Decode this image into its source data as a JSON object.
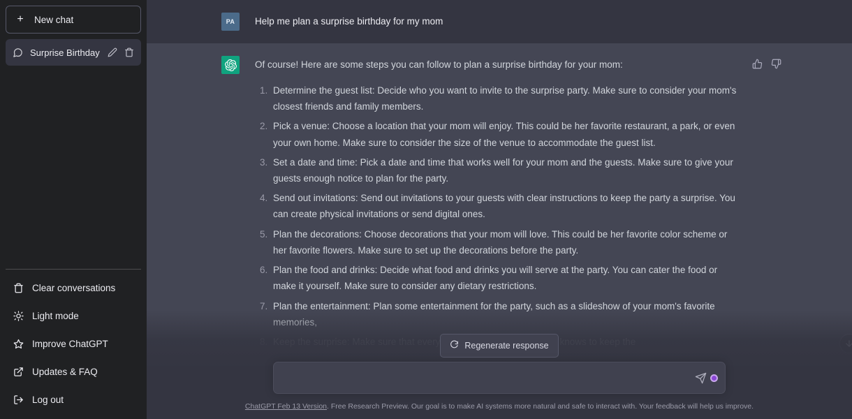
{
  "sidebar": {
    "new_chat_label": "New chat",
    "new_chat_icon": "plus-icon",
    "conversations": [
      {
        "title": "Surprise Birthday Planni",
        "chat_icon": "message-square-icon",
        "edit_icon": "pencil-icon",
        "delete_icon": "trash-icon",
        "active": true
      }
    ],
    "menu": [
      {
        "label": "Clear conversations",
        "icon": "trash-icon"
      },
      {
        "label": "Light mode",
        "icon": "sun-icon"
      },
      {
        "label": "Improve ChatGPT",
        "icon": "star-icon"
      },
      {
        "label": "Updates & FAQ",
        "icon": "external-link-icon"
      },
      {
        "label": "Log out",
        "icon": "logout-icon"
      }
    ]
  },
  "conversation": {
    "user_message": {
      "avatar_initials": "PA",
      "text": "Help me plan a surprise birthday for my mom"
    },
    "assistant_message": {
      "avatar_icon": "chatgpt-logo-icon",
      "intro": "Of course! Here are some steps you can follow to plan a surprise birthday for your mom:",
      "thumbs_up_icon": "thumbs-up-icon",
      "thumbs_down_icon": "thumbs-down-icon",
      "steps": [
        "Determine the guest list: Decide who you want to invite to the surprise party. Make sure to consider your mom's closest friends and family members.",
        "Pick a venue: Choose a location that your mom will enjoy. This could be her favorite restaurant, a park, or even your own home. Make sure to consider the size of the venue to accommodate the guest list.",
        "Set a date and time: Pick a date and time that works well for your mom and the guests. Make sure to give your guests enough notice to plan for the party.",
        "Send out invitations: Send out invitations to your guests with clear instructions to keep the party a surprise. You can create physical invitations or send digital ones.",
        "Plan the decorations: Choose decorations that your mom will love. This could be her favorite color scheme or her favorite flowers. Make sure to set up the decorations before the party.",
        "Plan the food and drinks: Decide what food and drinks you will serve at the party. You can cater the food or make it yourself. Make sure to consider any dietary restrictions.",
        "Plan the entertainment: Plan some entertainment for the party, such as a slideshow of your mom's favorite memories,",
        "Keep the surprise: Make sure that everyone involved in the planning knows to keep the"
      ]
    }
  },
  "bottom": {
    "regenerate_label": "Regenerate response",
    "regenerate_icon": "refresh-icon",
    "composer": {
      "value": "",
      "placeholder": "",
      "send_icon": "send-icon",
      "record_icon": "record-dot-icon"
    },
    "scroll_button_icon": "scroll-down-icon",
    "footer": {
      "link_text": "ChatGPT Feb 13 Version",
      "disclaimer": ". Free Research Preview. Our goal is to make AI systems more natural and safe to interact with. Your feedback will help us improve."
    }
  },
  "colors": {
    "sidebar_bg": "#202123",
    "user_row_bg": "#343541",
    "assistant_row_bg": "#444654",
    "brand_green": "#10a37f",
    "accent_purple": "#8b46d6"
  }
}
